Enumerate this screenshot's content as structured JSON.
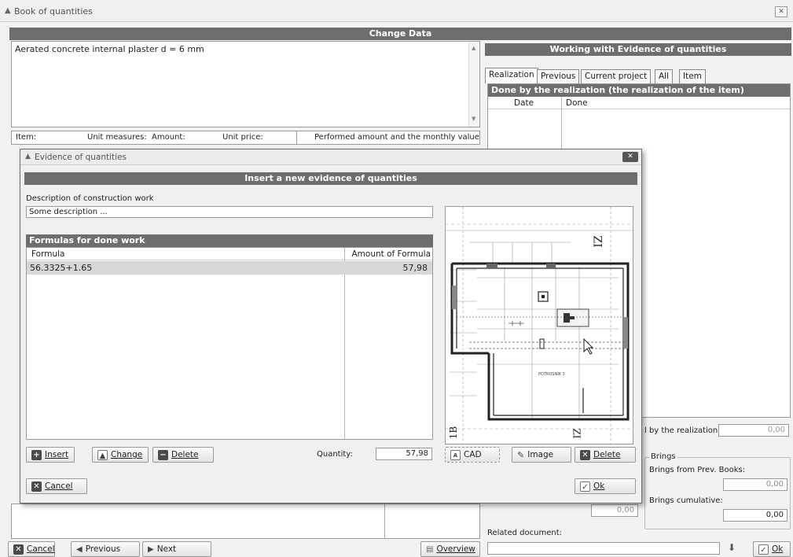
{
  "window": {
    "title": "Book of quantities",
    "close_glyph": "✕"
  },
  "change_data": {
    "title": "Change Data",
    "description": "Aerated concrete internal plaster d = 6 mm"
  },
  "item_header": {
    "item": "Item:",
    "unit_measures": "Unit measures:",
    "amount": "Amount:",
    "unit_price": "Unit price:",
    "performed": "Performed amount and the monthly value"
  },
  "evidence_panel": {
    "title": "Working with Evidence of quantities",
    "tabs": [
      "Realization",
      "Previous",
      "Current project",
      "All",
      "Item"
    ],
    "done_title": "Done by the realization (the realization of the item)",
    "columns": [
      "Date",
      "Done"
    ],
    "total_label": "l by the realization:",
    "total_value": "0,00"
  },
  "brings": {
    "group_label": "Brings",
    "prev_label": "Brings from Prev. Books:",
    "prev_value": "0,00",
    "cumulative_label": "Brings cumulative:",
    "cumulative_value": "0,00",
    "hidden_value": "0,00"
  },
  "related": {
    "label": "Related document:",
    "value": ""
  },
  "bottom": {
    "cancel": "Cancel",
    "previous": "Previous",
    "next": "Next",
    "overview": "Overview",
    "ok": "Ok"
  },
  "dialog": {
    "title": "Evidence of quantities",
    "header": "Insert a new evidence of quantities",
    "desc_label": "Description of construction work",
    "desc_value": "Some description ...",
    "formulas_title": "Formulas for done work",
    "columns": [
      "Formula",
      "Amount of Formula"
    ],
    "rows": [
      {
        "formula": "56.3325+1.65",
        "amount": "57,98"
      }
    ],
    "buttons": {
      "insert": "Insert",
      "change": "Change",
      "delete": "Delete",
      "cad": "CAD",
      "image": "Image",
      "delete2": "Delete",
      "cancel": "Cancel",
      "ok": "Ok"
    },
    "quantity_label": "Quantity:",
    "quantity_value": "57,98",
    "plan_labels": {
      "top_right": "ZI",
      "bottom_left": "1B",
      "bottom_mid": "ZI",
      "room": "POTROSNIK 3"
    }
  },
  "icons": [
    "window-logo-icon",
    "close-icon",
    "scroll-up-icon",
    "scroll-down-icon",
    "insert-icon",
    "change-icon",
    "delete-icon",
    "cad-icon",
    "image-icon",
    "cancel-icon",
    "ok-icon",
    "previous-icon",
    "next-icon",
    "overview-icon",
    "download-icon"
  ]
}
